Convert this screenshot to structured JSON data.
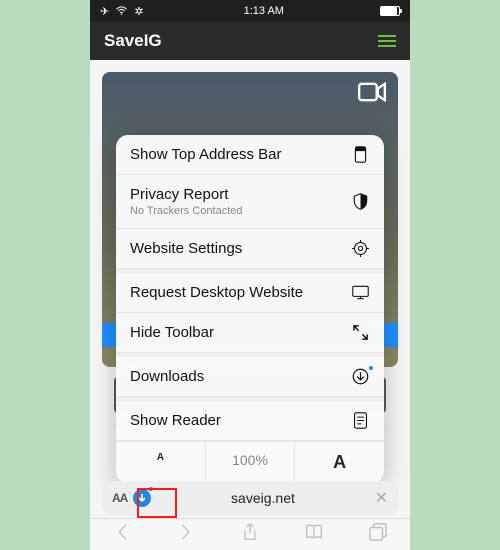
{
  "status": {
    "time": "1:13 AM"
  },
  "header": {
    "title": "SaveIG"
  },
  "menu": {
    "show_top": "Show Top Address Bar",
    "privacy": "Privacy Report",
    "privacy_sub": "No Trackers Contacted",
    "settings": "Website Settings",
    "desktop": "Request Desktop Website",
    "hide_toolbar": "Hide Toolbar",
    "downloads": "Downloads",
    "reader": "Show Reader",
    "smallA": "A",
    "zoom": "100%",
    "bigA": "A"
  },
  "url": {
    "aa": "AA",
    "domain": "saveig.net",
    "close": "✕"
  }
}
